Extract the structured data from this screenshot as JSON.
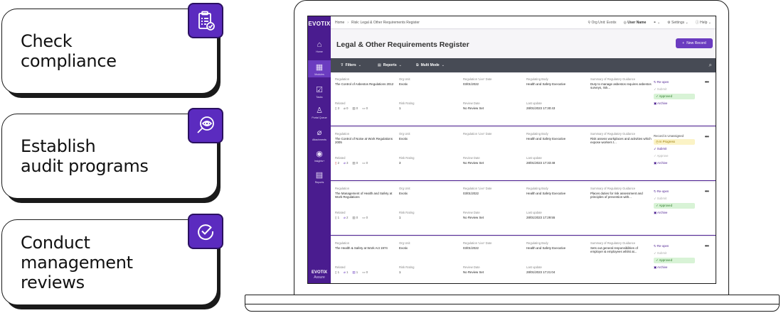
{
  "cards": [
    {
      "text": "Check\ncompliance",
      "icon": "clipboard-check-icon"
    },
    {
      "text": "Establish\naudit programs",
      "icon": "magnifier-eye-icon"
    },
    {
      "text": "Conduct\nmanagement\nreviews",
      "icon": "check-circle-icon"
    }
  ],
  "app": {
    "logo": "EVOTIX",
    "bottom_logo": "EVOTIX",
    "bottom_logo_sub": "Assure",
    "sidebar": [
      {
        "label": "Home",
        "icon": "home-icon"
      },
      {
        "label": "Modules",
        "icon": "grid-icon"
      },
      {
        "label": "Tasks",
        "icon": "tasks-icon"
      },
      {
        "label": "Portal Queue",
        "icon": "portal-queue-icon"
      },
      {
        "label": "Attachments",
        "icon": "paperclip-icon"
      },
      {
        "label": "Insights+",
        "icon": "insights-icon"
      },
      {
        "label": "Reports",
        "icon": "reports-icon"
      }
    ],
    "breadcrumb": {
      "home": "Home",
      "current": "Risk: Legal & Other Requirements Register"
    },
    "topbar": {
      "org_unit": "Org Unit: Evotix",
      "user": "User Name",
      "settings": "Settings",
      "help": "Help"
    },
    "page_title": "Legal & Other Requirements Register",
    "new_record": "New Record",
    "toolbar": {
      "filters": "Filters",
      "reports": "Reports",
      "multi_mode": "Multi Mode"
    },
    "labels": {
      "regulation": "Regulation",
      "org_unit": "Org Unit",
      "live_date": "Regulation 'Live' Date",
      "body": "Regulating Body",
      "summary": "Summary of Regulatory Guidance",
      "related": "Related",
      "risk": "Risk Rating",
      "review": "Review Date",
      "updated": "Last update"
    },
    "records": [
      {
        "regulation": "The Control of Asbestos Regulations 2012",
        "org_unit": "Evotix",
        "live_date": "03/01/2022",
        "body": "Health and Safety Executive",
        "summary": "Duty to manage asbestos requires asbestos surveys, risk...",
        "related": [
          "3",
          "0",
          "0",
          "0"
        ],
        "risk": "1",
        "review": "No Review Set",
        "updated": "28/01/2023 17:30:43",
        "actions": [
          {
            "label": "Re-open",
            "kind": "normal"
          },
          {
            "label": "Submit",
            "kind": "disabled"
          },
          {
            "label": "Approved",
            "kind": "approved"
          },
          {
            "label": "Archive",
            "kind": "normal"
          }
        ]
      },
      {
        "regulation": "The Control of Noise at Work Regulations 2005",
        "org_unit": "Evotix",
        "live_date": "",
        "body": "Health and Safety Executive",
        "summary": "Risk assess workplaces and activities which expose workers t...",
        "related": [
          "2",
          "3",
          "0",
          "0"
        ],
        "risk": "3",
        "review": "No Review Set",
        "updated": "28/01/2023 17:33:48",
        "record_note": "Record is Unassigned",
        "actions": [
          {
            "label": "In Progress",
            "kind": "inprog"
          },
          {
            "label": "Submit",
            "kind": "normal"
          },
          {
            "label": "Approve",
            "kind": "disabled"
          },
          {
            "label": "Archive",
            "kind": "normal"
          }
        ]
      },
      {
        "regulation": "The Management of Health and Safety at Work Regulations",
        "org_unit": "Evotix",
        "live_date": "03/01/2022",
        "body": "Health and Safety Executive",
        "summary": "Places duties for risk assessment and principles of prevention with...",
        "related": [
          "1",
          "2",
          "0",
          "0"
        ],
        "risk": "1",
        "review": "No Review Set",
        "updated": "28/01/2023 17:29:55",
        "actions": [
          {
            "label": "Re-open",
            "kind": "normal"
          },
          {
            "label": "Submit",
            "kind": "disabled"
          },
          {
            "label": "Approved",
            "kind": "approved"
          },
          {
            "label": "Archive",
            "kind": "normal"
          }
        ]
      },
      {
        "regulation": "The Health & Safety at Work Act 1974",
        "org_unit": "Evotix",
        "live_date": "03/01/2022",
        "body": "Health and Safety Executive",
        "summary": "Sets out general responsibilities of employer & employees whilst at...",
        "related": [
          "1",
          "1",
          "1",
          "0"
        ],
        "risk": "1",
        "review": "No Review Set",
        "updated": "28/01/2023 17:21:04",
        "actions": [
          {
            "label": "Re-open",
            "kind": "normal"
          },
          {
            "label": "Submit",
            "kind": "disabled"
          },
          {
            "label": "Approved",
            "kind": "approved"
          },
          {
            "label": "Archive",
            "kind": "normal"
          }
        ]
      }
    ]
  },
  "colors": {
    "brand": "#4a1c8f",
    "accent": "#6b3cc0",
    "toolbar": "#474b55",
    "approved": "#d8f3d6",
    "in_progress": "#fbf3c6"
  }
}
